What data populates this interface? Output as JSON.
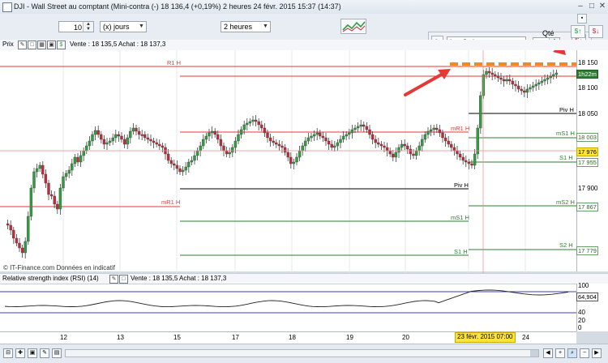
{
  "window": {
    "title": "DJI - Wall Street au comptant (Mini-contra (-)    18 136,4 (+0,19%)    2 heures  24 févr. 2015 15:37 (14:37)"
  },
  "toolbar": {
    "period_value": "10",
    "period_unit": "(x) jours",
    "interval": "2 heures",
    "order_type": "LmtOrder",
    "qty_label": "Qté",
    "qty_value": "1"
  },
  "price_pane": {
    "label": "Prix",
    "quote": "Vente : 18 135,5  Achat : 18 137,3",
    "watermark": "© IT-Finance.com  Données en indicatif",
    "timer": "1h22m"
  },
  "rsi_pane": {
    "label": "Relative strength index (RSI) (14)",
    "quote": "Vente : 18 135,5  Achat : 18 137,3",
    "value_badge": "64,904"
  },
  "y_axis": {
    "ticks": [
      "18 150",
      "18 100",
      "18 050",
      "17 900",
      "17 779"
    ]
  },
  "pivot_levels": [
    {
      "label": "R1 H",
      "value": "18 145",
      "color": "#e53935"
    },
    {
      "label": "mR1 H",
      "value": "18 097",
      "color": "#e53935"
    },
    {
      "label": "Piv H",
      "value": "18 055",
      "color": "#000000"
    },
    {
      "label": "mR1 H",
      "value": "18 028",
      "color": "#e53935"
    },
    {
      "label": "mS1 H",
      "value": "18 003",
      "color": "#2e7d32"
    },
    {
      "label": "S1 H",
      "value": "17 955",
      "color": "#2e7d32"
    },
    {
      "label": "Piv H",
      "value": "17 908",
      "color": "#000000"
    },
    {
      "label": "mR1 H",
      "value": "17 868",
      "color": "#e53935"
    },
    {
      "label": "mS2 H",
      "value": "17 867",
      "color": "#2e7d32"
    },
    {
      "label": "mS1 H",
      "value": "17 839",
      "color": "#2e7d32"
    },
    {
      "label": "S2 H",
      "value": "17 779",
      "color": "#2e7d32"
    },
    {
      "label": "S1 H",
      "value": "17 764",
      "color": "#2e7d32"
    }
  ],
  "price_badges": {
    "current": "17 976",
    "dotted": "18 145"
  },
  "rsi_axis": {
    "ticks": [
      "100",
      "80",
      "40",
      "20",
      "0"
    ]
  },
  "x_axis": {
    "labels": [
      "12",
      "13",
      "15",
      "17",
      "18",
      "19",
      "20",
      "24"
    ],
    "highlight": "23 févr. 2015 07:00"
  },
  "colors": {
    "up": "#2e9e3e",
    "down": "#c62839",
    "resistance": "#e53935",
    "support": "#2e7d32",
    "arrow": "#e53935",
    "dashed": "#f08a24",
    "rsi": "#222222",
    "band": "#3f3fbf"
  }
}
